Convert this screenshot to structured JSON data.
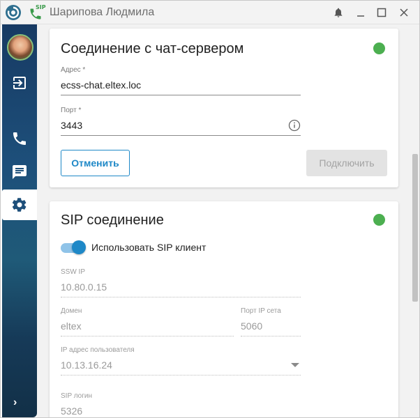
{
  "titlebar": {
    "sip_badge": "SIP",
    "user_name": "Шарипова Людмила",
    "icons": [
      "app-logo-icon",
      "sip-phone-icon",
      "bell-icon",
      "minimize-icon",
      "maximize-icon",
      "close-icon"
    ]
  },
  "sidebar": {
    "items": [
      "avatar",
      "logout-icon",
      "phone-icon",
      "chat-icon",
      "settings-icon"
    ],
    "active": "settings-icon",
    "expand_glyph": "›"
  },
  "chat_server": {
    "title": "Соединение с чат-сервером",
    "status_color": "#4caf50",
    "address_label": "Адрес *",
    "address_value": "ecss-chat.eltex.loc",
    "port_label": "Порт *",
    "port_value": "3443",
    "cancel_label": "Отменить",
    "connect_label": "Подключить"
  },
  "sip": {
    "title": "SIP соединение",
    "status_color": "#4caf50",
    "toggle_label": "Использовать SIP клиент",
    "toggle_on": true,
    "ssw_ip_label": "SSW IP",
    "ssw_ip_value": "10.80.0.15",
    "domain_label": "Домен",
    "domain_value": "eltex",
    "port_label": "Порт IP сета",
    "port_value": "5060",
    "user_ip_label": "IP адрес пользователя",
    "user_ip_value": "10.13.16.24",
    "login_label": "SIP логин",
    "login_value": "5326"
  },
  "colors": {
    "accent": "#1e88c7",
    "status": "#4caf50",
    "sidebar": "#1d4f7a"
  }
}
